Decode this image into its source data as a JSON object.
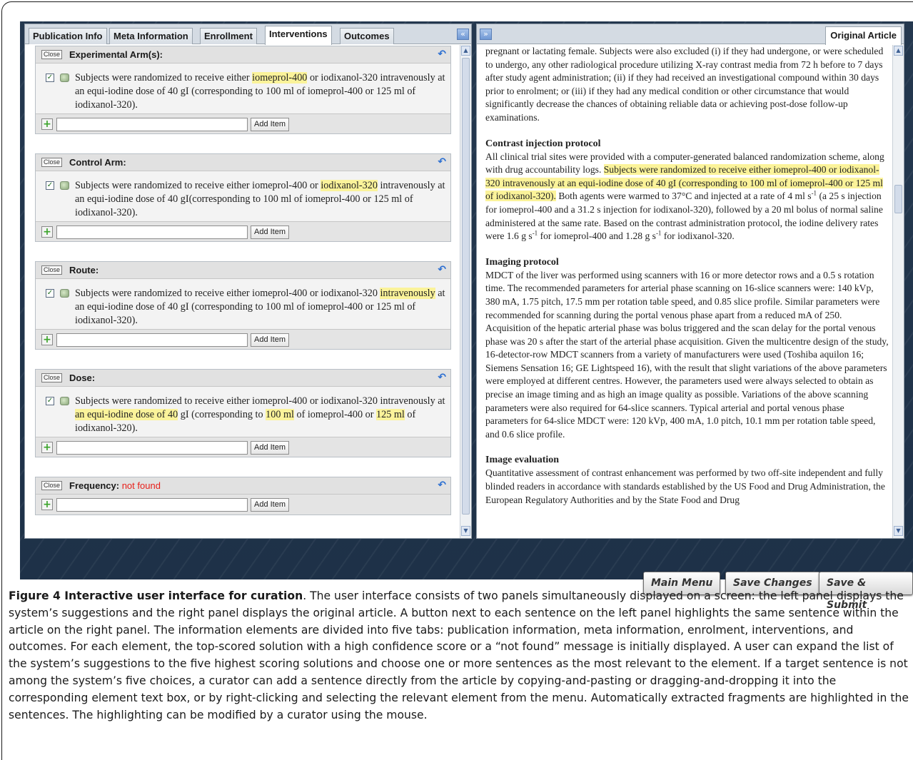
{
  "tabs": [
    "Publication Info",
    "Meta Information",
    "Enrollment",
    "Interventions",
    "Outcomes"
  ],
  "active_tab": "Interventions",
  "left_collapse": "«",
  "right_expand": "»",
  "close_label": "Close",
  "add_item_label": "Add Item",
  "elements": [
    {
      "title": "Experimental Arm(s):",
      "status": "",
      "sentence": [
        {
          "t": "Subjects were randomized to receive either "
        },
        {
          "t": "iomeprol-400",
          "hl": true
        },
        {
          "t": " or iodixanol-320 intravenously at an equi-iodine dose of 40 gI (corresponding to 100 ml of iomeprol-400 or 125 ml of iodixanol-320)."
        }
      ]
    },
    {
      "title": "Control Arm:",
      "status": "",
      "sentence": [
        {
          "t": "Subjects were randomized to receive either iomeprol-400 or "
        },
        {
          "t": "iodixanol-320",
          "hl": true
        },
        {
          "t": " intravenously at an equi-iodine dose of 40 gI(corresponding to 100 ml of iomeprol-400 or 125 ml of iodixanol-320)."
        }
      ]
    },
    {
      "title": "Route:",
      "status": "",
      "sentence": [
        {
          "t": "Subjects were randomized to receive either iomeprol-400 or iodixanol-320 "
        },
        {
          "t": "intravenously",
          "hl": true
        },
        {
          "t": " at an equi-iodine dose of 40 gI (corresponding to 100 ml of iomeprol-400 or 125 ml of iodixanol-320)."
        }
      ]
    },
    {
      "title": "Dose:",
      "status": "",
      "sentence": [
        {
          "t": "Subjects were randomized to receive either iomeprol-400 or iodixanol-320 intravenously at "
        },
        {
          "t": "an equi-iodine dose of 40",
          "hl": true
        },
        {
          "t": " gI (corresponding to "
        },
        {
          "t": "100 ml",
          "hl": true
        },
        {
          "t": " of iomeprol-400 or "
        },
        {
          "t": "125 ml",
          "hl": true
        },
        {
          "t": " of iodixanol-320)."
        }
      ]
    },
    {
      "title": "Frequency:",
      "status": "not found",
      "sentence": []
    }
  ],
  "right_tab": "Original Article",
  "article": {
    "intro": "pregnant or lactating female. Subjects were also excluded (i) if they had undergone, or were scheduled to undergo, any other radiological procedure utilizing X-ray contrast media from 72 h before to 7 days after study agent administration; (ii) if they had received an investigational compound within 30 days prior to enrolment; or (iii) if they had any medical condition or other circumstance that would significantly decrease the chances of obtaining reliable data or achieving post-dose follow-up examinations.",
    "contrast_heading": "Contrast injection protocol",
    "contrast_pre": "All clinical trial sites were provided with a computer-generated balanced randomization scheme, along with drug accountability logs. ",
    "contrast_hl": "Subjects were randomized to receive either iomeprol-400 or iodixanol-320 intravenously at an equi-iodine dose of 40 gI (corresponding to 100 ml of iomeprol-400 or 125 ml of iodixanol-320).",
    "contrast_post_a": " Both agents were warmed to 37°C and injected at a rate of 4 ml s",
    "contrast_sup1": "-1",
    "contrast_post_b": " (a 25 s injection for iomeprol-400 and a 31.2 s injection for iodixanol-320), followed by a 20 ml bolus of normal saline administered at the same rate. Based on the contrast administration protocol, the iodine delivery rates were 1.6 g s",
    "contrast_sup2": "-1",
    "contrast_post_c": " for iomeprol-400 and 1.28 g s",
    "contrast_sup3": "-1",
    "contrast_post_d": " for iodixanol-320.",
    "imaging_heading": "Imaging protocol",
    "imaging_text": "MDCT of the liver was performed using scanners with 16 or more detector rows and a 0.5 s rotation time. The recommended parameters for arterial phase scanning on 16-slice scanners were: 140 kVp, 380 mA, 1.75 pitch, 17.5 mm per rotation table speed, and 0.85 slice profile. Similar parameters were recommended for scanning during the portal venous phase apart from a reduced mA of 250. Acquisition of the hepatic arterial phase was bolus triggered and the scan delay for the portal venous phase was 20 s after the start of the arterial phase acquisition. Given the multicentre design of the study, 16-detector-row MDCT scanners from a variety of manufacturers were used (Toshiba aquilon 16; Siemens Sensation 16; GE Lightspeed 16), with the result that slight variations of the above parameters were employed at different centres. However, the parameters used were always selected to obtain as precise an image timing and as high an image quality as possible. Variations of the above scanning parameters were also required for 64-slice scanners. Typical arterial and portal venous phase parameters for 64-slice MDCT were: 120 kVp, 400 mA, 1.0 pitch, 10.1 mm per rotation table speed, and 0.6 slice profile.",
    "eval_heading": "Image evaluation",
    "eval_text": "Quantitative assessment of contrast enhancement was performed by two off-site independent and fully blinded readers in accordance with standards established by the US Food and Drug Administration, the European Regulatory Authorities and by the State Food and Drug"
  },
  "buttons": {
    "main_menu": "Main Menu",
    "save_changes": "Save Changes",
    "save_submit": "Save & Submit"
  },
  "caption": {
    "figure_label": "Figure 4 Interactive user interface for curation",
    "text": ". The user interface consists of two panels simultaneously displayed on a screen: the left panel displays the system’s suggestions and the right panel displays the original article. A button next to each sentence on the left panel highlights the same sentence within the article on the right panel. The information elements are divided into five tabs: publication information, meta information, enrolment, interventions, and outcomes. For each element, the top-scored solution with a high confidence score or a “not found” message is initially displayed. A user can expand the list of the system’s suggestions to the five highest scoring solutions and choose one or more sentences as the most relevant to the element. If a target sentence is not among the system’s five choices, a curator can add a sentence directly from the article by copying-and-pasting or dragging-and-dropping it into the corresponding element text box, or by right-clicking and selecting the relevant element from the menu. Automatically extracted fragments are highlighted in the sentences. The highlighting can be modified by a curator using the mouse."
  },
  "colors": {
    "highlight": "#fbf39a",
    "not_found": "#e8201b",
    "app_background": "#263950"
  },
  "icons": [
    "checkbox-checked-icon",
    "locate-sentence-icon",
    "undo-icon",
    "add-icon",
    "collapse-left-icon",
    "expand-right-icon"
  ]
}
